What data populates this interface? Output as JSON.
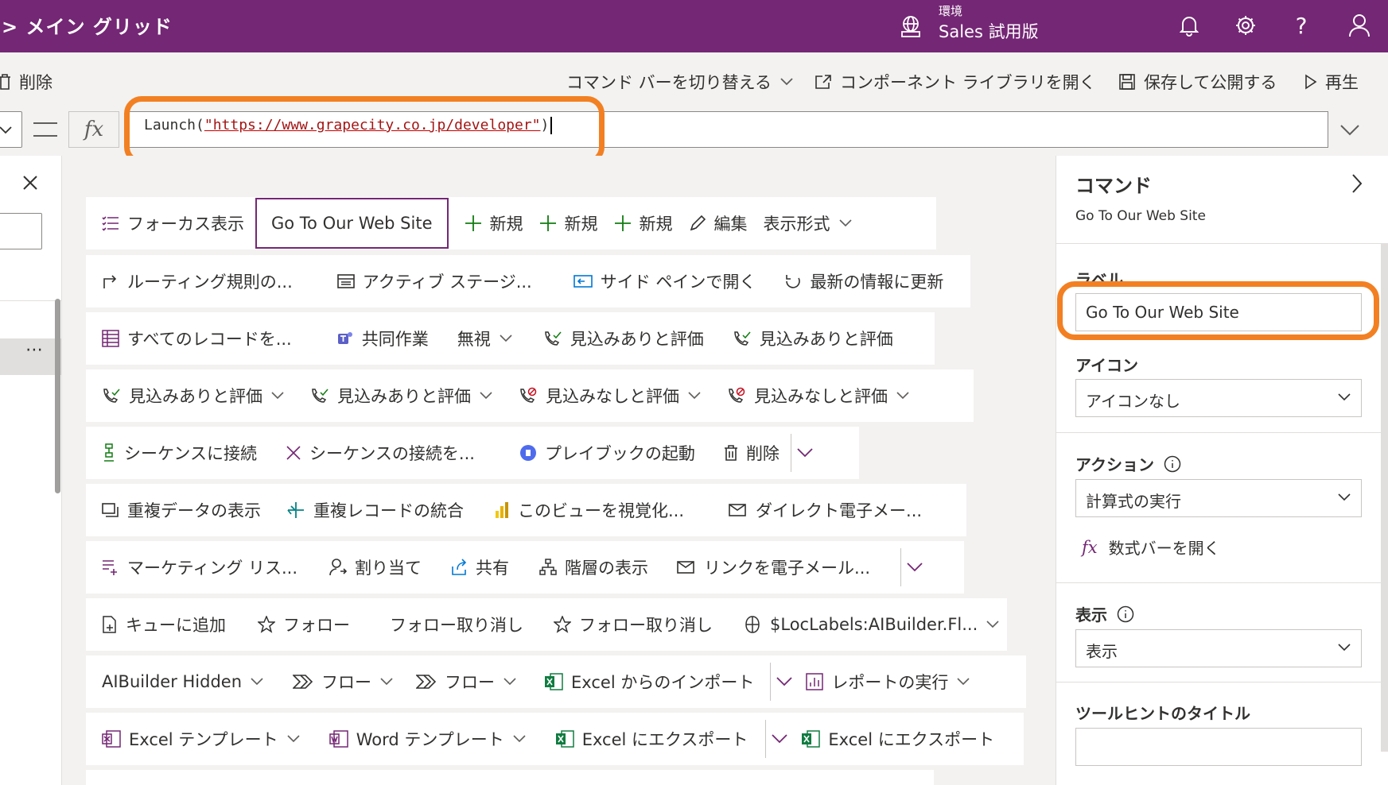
{
  "topbar": {
    "title": "> メイン グリッド",
    "env_label": "環境",
    "env_value": "Sales 試用版",
    "icons": [
      "environment-icon",
      "bell-icon",
      "gear-icon",
      "help-icon",
      "user-icon"
    ]
  },
  "cmdbar": {
    "delete": "削除",
    "toggle": "コマンド バーを切り替える",
    "component_library": "コンポーネント ライブラリを開く",
    "save_publish": "保存して公開する",
    "play": "再生"
  },
  "formula": {
    "fn": "Launch(",
    "url": "\"https://www.grapecity.co.jp/developer\"",
    "close": ")"
  },
  "canvas": {
    "rows": [
      [
        "フォーカス表示",
        "Go To Our Web Site",
        "新規",
        "新規",
        "新規",
        "編集",
        "表示形式"
      ],
      [
        "ルーティング規則の...",
        "アクティブ ステージ...",
        "サイド ペインで開く",
        "最新の情報に更新"
      ],
      [
        "すべてのレコードを...",
        "共同作業",
        "無視",
        "見込みありと評価",
        "見込みありと評価"
      ],
      [
        "見込みありと評価",
        "見込みありと評価",
        "見込みなしと評価",
        "見込みなしと評価"
      ],
      [
        "シーケンスに接続",
        "シーケンスの接続を...",
        "プレイブックの起動",
        "削除"
      ],
      [
        "重複データの表示",
        "重複レコードの統合",
        "このビューを視覚化...",
        "ダイレクト電子メー..."
      ],
      [
        "マーケティング リス...",
        "割り当て",
        "共有",
        "階層の表示",
        "リンクを電子メール..."
      ],
      [
        "キューに追加",
        "フォロー",
        "フォロー取り消し",
        "フォロー取り消し",
        "$LocLabels:AIBuilder.Fl..."
      ],
      [
        "AIBuilder Hidden",
        "フロー",
        "フロー",
        "Excel からのインポート",
        "レポートの実行"
      ],
      [
        "Excel テンプレート",
        "Word テンプレート",
        "Excel にエクスポート",
        "Excel にエクスポート"
      ]
    ]
  },
  "panel": {
    "title": "コマンド",
    "subtitle": "Go To Our Web Site",
    "label_heading": "ラベル",
    "label_value": "Go To Our Web Site",
    "icon_heading": "アイコン",
    "icon_value": "アイコンなし",
    "action_heading": "アクション",
    "action_value": "計算式の実行",
    "open_formula": "数式バーを開く",
    "fx": "fx",
    "visibility_heading": "表示",
    "visibility_value": "表示",
    "tooltip_heading": "ツールヒントのタイトル",
    "tooltip_value": ""
  },
  "colors": {
    "brand": "#742774",
    "highlight": "#f28022"
  }
}
